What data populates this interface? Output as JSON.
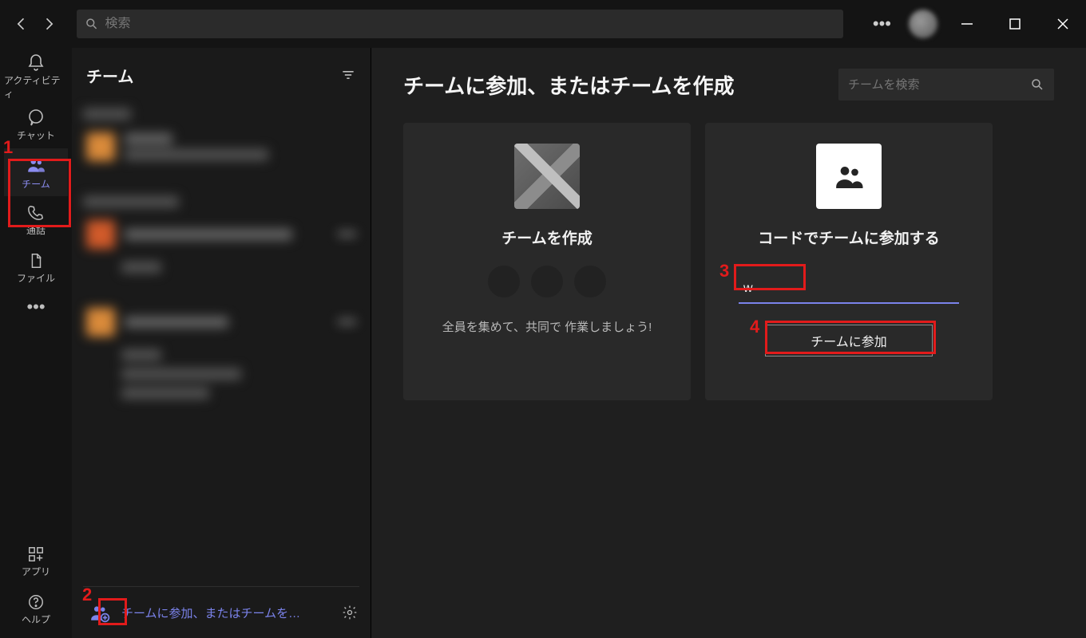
{
  "topbar": {
    "search_placeholder": "検索"
  },
  "rail": {
    "activity": "アクティビティ",
    "chat": "チャット",
    "teams": "チーム",
    "calls": "通話",
    "files": "ファイル",
    "apps": "アプリ",
    "help": "ヘルプ"
  },
  "panel": {
    "title": "チーム",
    "footer_link": "チームに参加、またはチームを…"
  },
  "main": {
    "title": "チームに参加、またはチームを作成",
    "team_search_placeholder": "チームを検索",
    "create_card": {
      "title": "チームを作成",
      "desc": "全員を集めて、共同で 作業しましょう!"
    },
    "join_card": {
      "title": "コードでチームに参加する",
      "code_value": "w",
      "join_button": "チームに参加"
    }
  },
  "annotations": {
    "n1": "1",
    "n2": "2",
    "n3": "3",
    "n4": "4"
  }
}
